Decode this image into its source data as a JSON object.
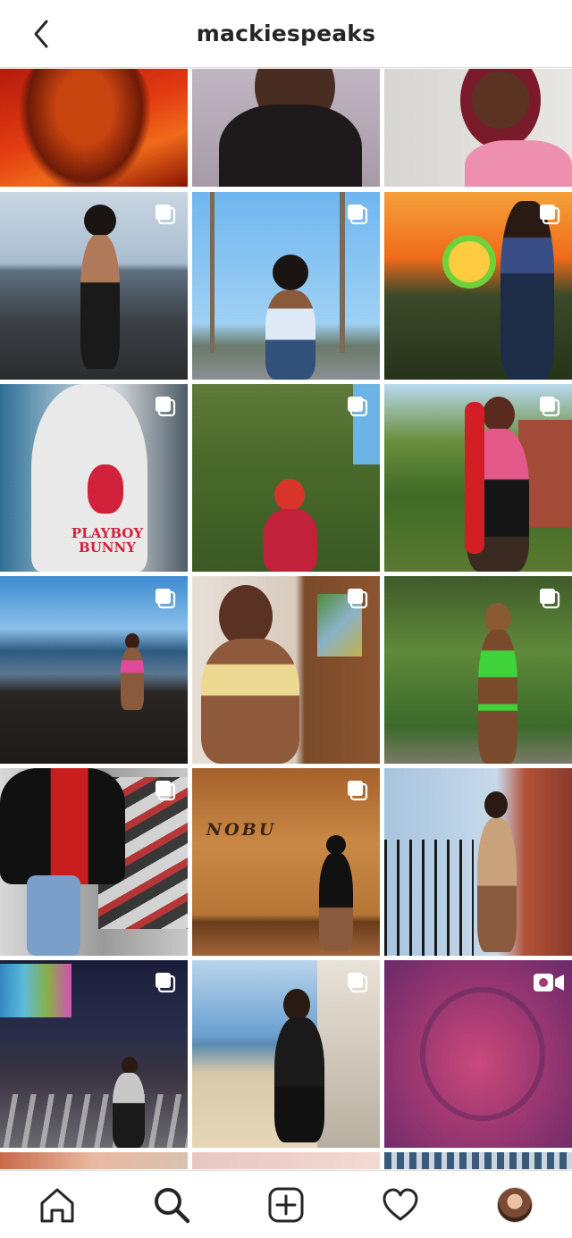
{
  "header": {
    "title": "mackiespeaks",
    "back_icon": "chevron-left-icon"
  },
  "grid": {
    "tiles": [
      {
        "badge": "none",
        "text": ""
      },
      {
        "badge": "none",
        "text": ""
      },
      {
        "badge": "none",
        "text": ""
      },
      {
        "badge": "multi",
        "text": ""
      },
      {
        "badge": "multi",
        "text": ""
      },
      {
        "badge": "multi",
        "text": ""
      },
      {
        "badge": "multi",
        "text": "PLAYBOY BUNNY"
      },
      {
        "badge": "multi",
        "text": ""
      },
      {
        "badge": "multi",
        "text": ""
      },
      {
        "badge": "multi",
        "text": ""
      },
      {
        "badge": "multi",
        "text": ""
      },
      {
        "badge": "multi",
        "text": ""
      },
      {
        "badge": "multi",
        "text": ""
      },
      {
        "badge": "multi",
        "text": "NOBU"
      },
      {
        "badge": "none",
        "text": ""
      },
      {
        "badge": "multi",
        "text": ""
      },
      {
        "badge": "multi",
        "text": ""
      },
      {
        "badge": "video",
        "text": ""
      }
    ]
  },
  "tabbar": {
    "items": [
      "home-icon",
      "search-icon",
      "new-post-icon",
      "activity-heart-icon",
      "profile-avatar"
    ]
  },
  "colors": {
    "border": "#dbdbdb",
    "text": "#262626"
  }
}
